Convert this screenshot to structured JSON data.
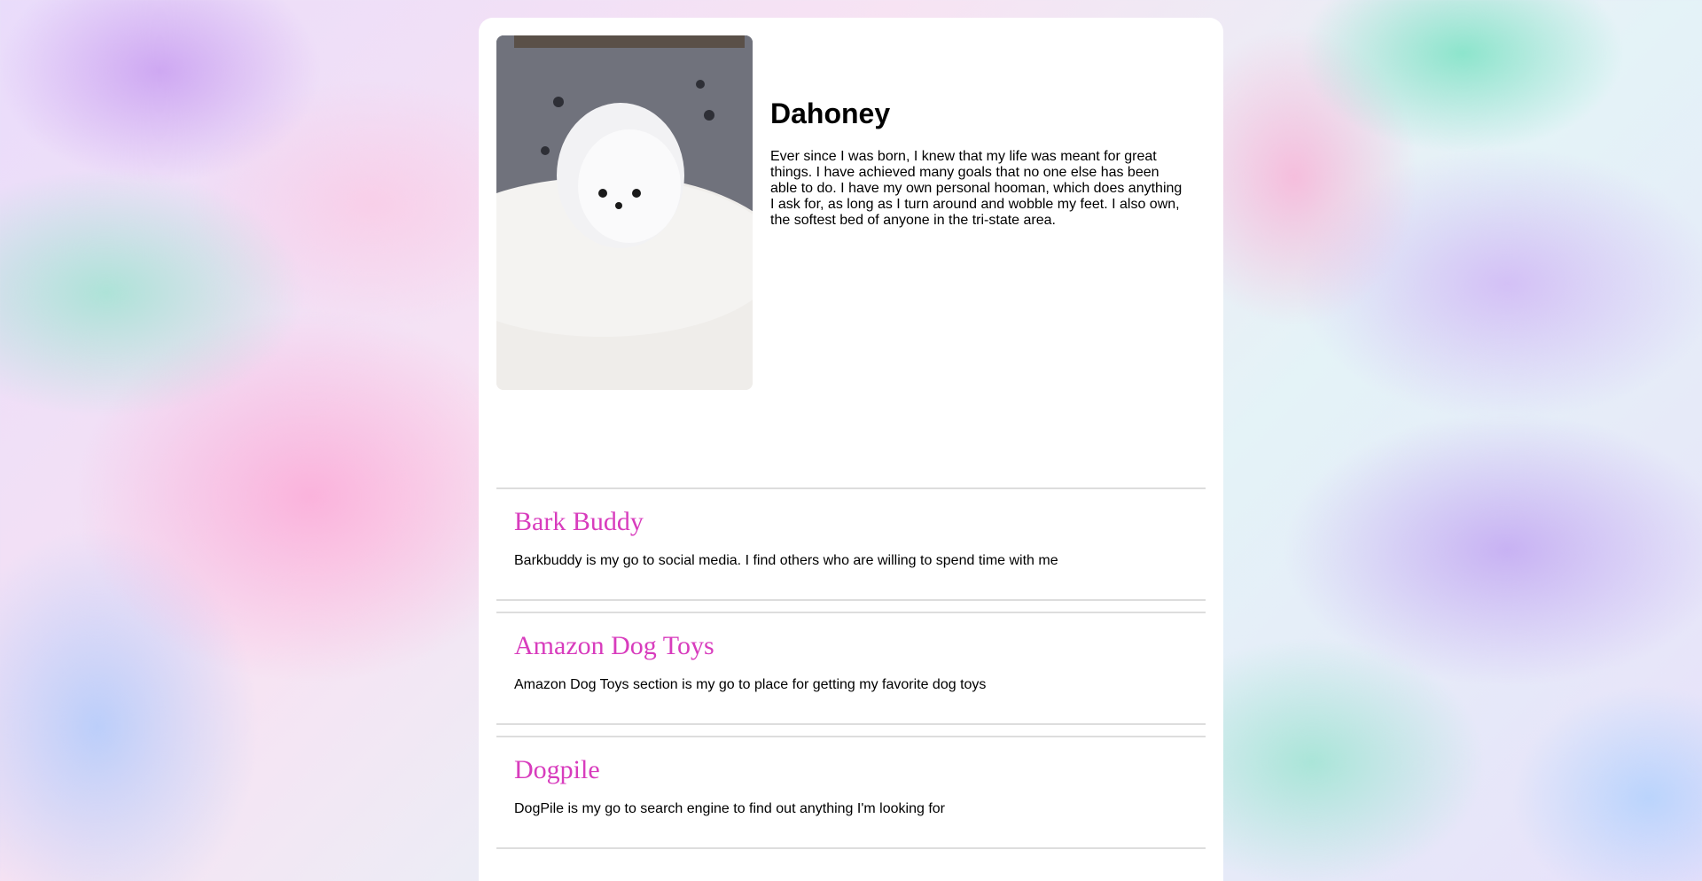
{
  "profile": {
    "name": "Dahoney",
    "bio": "Ever since I was born, I knew that my life was meant for great things. I have achieved many goals that no one else has been able to do. I have my own personal hooman, which does anything I ask for, as long as I turn around and wobble my feet. I also own, the softest bed of anyone in the tri-state area.",
    "photo_alt": "fluffy white pomeranian puppy on a white blanket"
  },
  "links": [
    {
      "title": "Bark Buddy",
      "description": "Barkbuddy is my go to social media. I find others who are willing to spend time with me"
    },
    {
      "title": "Amazon Dog Toys",
      "description": "Amazon Dog Toys section is my go to place for getting my favorite dog toys"
    },
    {
      "title": "Dogpile",
      "description": "DogPile is my go to search engine to find out anything I'm looking for"
    }
  ],
  "footer": {
    "text": ""
  },
  "colors": {
    "link_title": "#d83cbd",
    "card_background": "#ffffff",
    "divider": "#dddddd"
  }
}
